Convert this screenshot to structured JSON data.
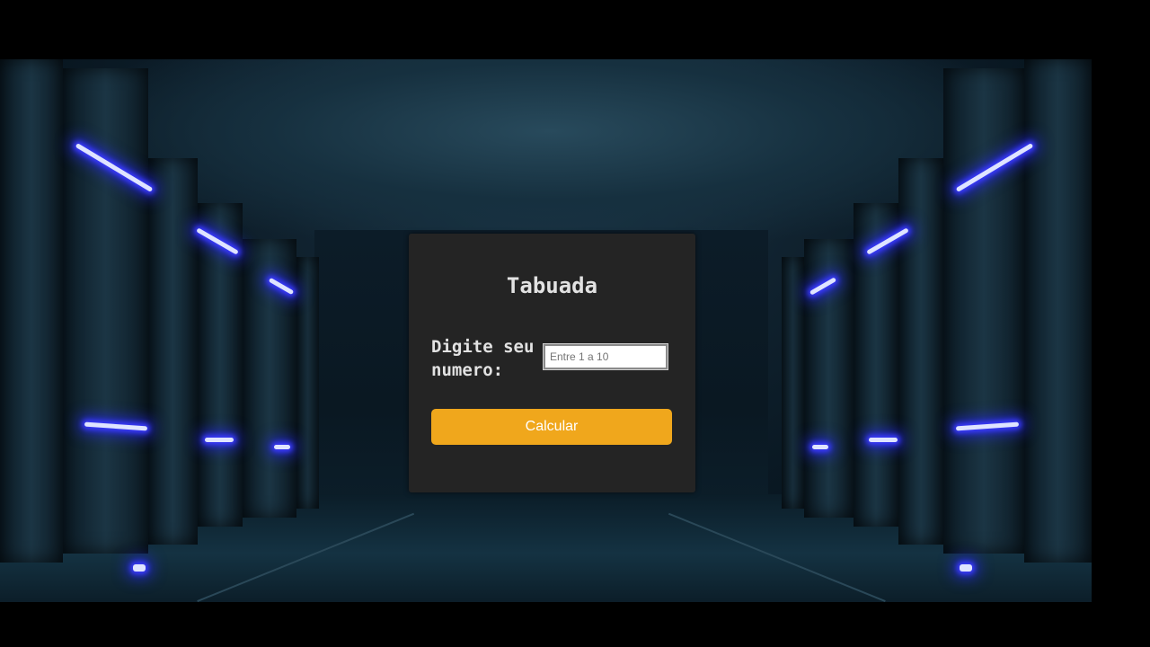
{
  "app": {
    "title": "Tabuada"
  },
  "form": {
    "label": "Digite seu numero:",
    "input_placeholder": "Entre 1 a 10",
    "input_value": "",
    "button_label": "Calcular"
  },
  "colors": {
    "card_background": "#242424",
    "button_accent": "#f0a71c",
    "neon_light": "#3b3bff",
    "page_background": "#000000"
  }
}
